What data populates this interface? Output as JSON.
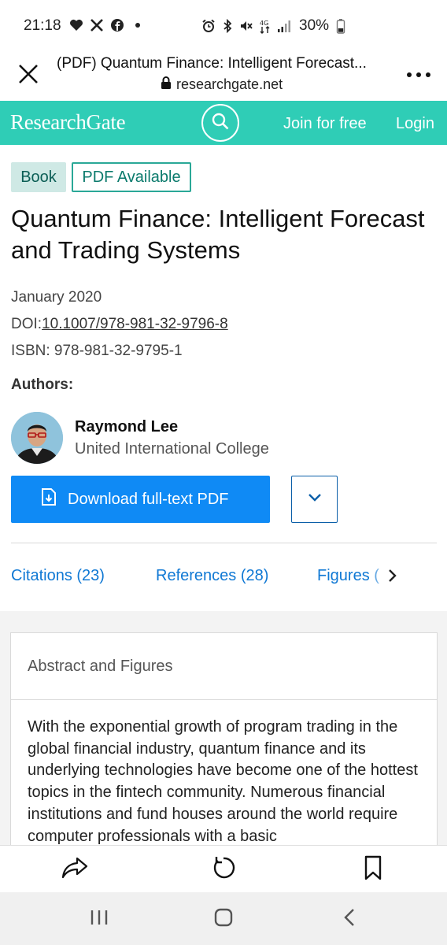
{
  "status_bar": {
    "time": "21:18",
    "battery": "30%",
    "left_icons": [
      "heart-icon",
      "x-icon",
      "facebook-icon",
      "dot-icon"
    ],
    "right_icons": [
      "alarm-icon",
      "bluetooth-icon",
      "mute-icon",
      "4g-icon",
      "signal-icon",
      "battery-icon"
    ]
  },
  "browser": {
    "title": "(PDF) Quantum Finance: Intelligent Forecast...",
    "url": "researchgate.net"
  },
  "site_header": {
    "logo": "ResearchGate",
    "join_label": "Join for free",
    "login_label": "Login",
    "brand_color": "#2fcdb6"
  },
  "publication": {
    "type_badge": "Book",
    "availability_badge": "PDF Available",
    "title": "Quantum Finance: Intelligent Forecast and Trading Systems",
    "date": "January 2020",
    "doi_label": "DOI:",
    "doi_value": "10.1007/978-981-32-9796-8",
    "isbn": "ISBN: 978-981-32-9795-1",
    "authors_label": "Authors:",
    "authors": [
      {
        "name": "Raymond Lee",
        "institution": "United International College"
      }
    ],
    "download_label": "Download full-text PDF"
  },
  "tabs": [
    {
      "label": "Citations (23)"
    },
    {
      "label": "References (28)"
    },
    {
      "label": "Figures ("
    }
  ],
  "abstract_card": {
    "heading": "Abstract and Figures",
    "text": "With the exponential growth of program trading in the global financial industry, quantum finance and its underlying technologies have become one of the hottest topics in the fintech community. Numerous financial institutions and fund houses around the world require computer professionals with a basic"
  }
}
